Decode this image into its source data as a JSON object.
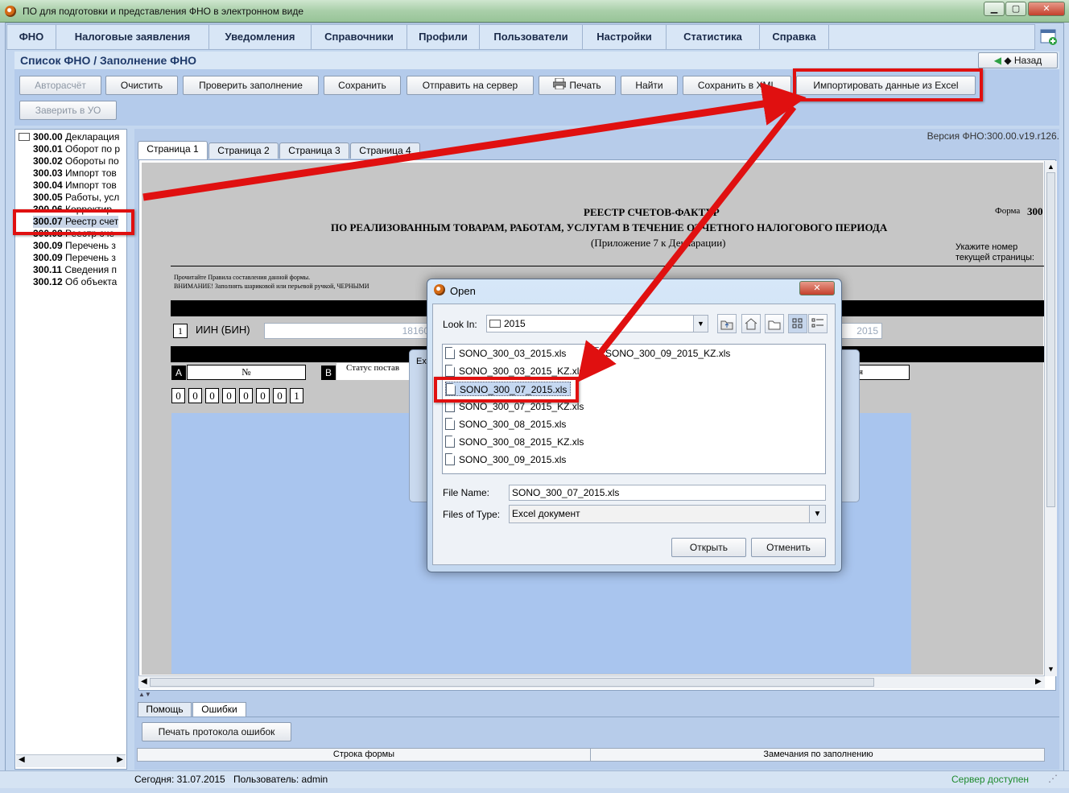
{
  "window": {
    "title": "ПО для подготовки и представления ФНО в электронном виде",
    "minimize": "▁",
    "maximize": "▢",
    "close": "✕"
  },
  "menu": [
    "ФНО",
    "Налоговые заявления",
    "Уведомления",
    "Справочники",
    "Профили",
    "Пользователи",
    "Настройки",
    "Статистика",
    "Справка"
  ],
  "header": {
    "title": "Список ФНО / Заполнение ФНО",
    "back": "◆ Назад"
  },
  "toolbar": {
    "autocalc": "Авторасчёт",
    "clear": "Очистить",
    "check": "Проверить заполнение",
    "save": "Сохранить",
    "send": "Отправить на сервер",
    "print": "Печать",
    "find": "Найти",
    "save_xml": "Сохранить в XML",
    "import_excel": "Импортировать данные из Excel",
    "certify": "Заверить в УО"
  },
  "tree": [
    {
      "code": "300.00",
      "label": "Декларация"
    },
    {
      "code": "300.01",
      "label": "Оборот по р"
    },
    {
      "code": "300.02",
      "label": "Обороты по"
    },
    {
      "code": "300.03",
      "label": "Импорт тов"
    },
    {
      "code": "300.04",
      "label": "Импорт тов"
    },
    {
      "code": "300.05",
      "label": "Работы, усл"
    },
    {
      "code": "300.06",
      "label": "Корректир"
    },
    {
      "code": "300.07",
      "label": "Реестр счет"
    },
    {
      "code": "300.08",
      "label": "Реестр сче"
    },
    {
      "code": "300.09",
      "label": "Перечень з"
    },
    {
      "code": "300.09",
      "label": "Перечень з"
    },
    {
      "code": "300.11",
      "label": "Сведения п"
    },
    {
      "code": "300.12",
      "label": "Об объекта"
    }
  ],
  "version": "Версия ФНО:300.00.v19.r126.",
  "tabs": [
    "Страница 1",
    "Страница 2",
    "Страница 3",
    "Страница 4"
  ],
  "form": {
    "title1": "РЕЕСТР СЧЕТОВ-ФАКТУР",
    "title2": "ПО РЕАЛИЗОВАННЫМ ТОВАРАМ, РАБОТАМ, УСЛУГАМ В ТЕЧЕНИЕ ОТЧЕТНОГО НАЛОГОВОГО ПЕРИОДА",
    "title3": "(Приложение 7 к Декларации)",
    "form_code_label": "Форма",
    "form_code": "300",
    "page_hint": "Укажите номер текущей страницы:",
    "rules_note": "Прочитайте Правила составления данной формы.",
    "warning_note": "ВНИМАНИЕ! Заполнять шариковой или перьевой ручкой, ЧЕРНЫМИ",
    "row1": "1",
    "iin_label": "ИИН (БИН)",
    "iin_value": "18160",
    "year_value": "2015",
    "col_a": "A",
    "col_no": "№",
    "col_b": "B",
    "col_status": "Статус постав",
    "col_tail": "я",
    "serial_digits": [
      "0",
      "0",
      "0",
      "0",
      "0",
      "0",
      "0",
      "1"
    ]
  },
  "bottom": {
    "help_tab": "Помощь",
    "errors_tab": "Ошибки",
    "print_errors": "Печать протокола ошибок",
    "col_row": "Строка формы",
    "col_remarks": "Замечания по заполнению"
  },
  "status": {
    "today": "Сегодня: 31.07.2015",
    "user": "Пользователь: admin",
    "server": "Сервер доступен"
  },
  "bg_dialog": {
    "title": "Ex"
  },
  "open_dialog": {
    "title": "Open",
    "look_in_label": "Look In:",
    "look_in_value": "2015",
    "files": [
      "SONO_300_03_2015.xls",
      "SONO_300_03_2015_KZ.xls",
      "SONO_300_07_2015.xls",
      "SONO_300_07_2015_KZ.xls",
      "SONO_300_08_2015.xls",
      "SONO_300_08_2015_KZ.xls",
      "SONO_300_09_2015.xls"
    ],
    "files_col2": [
      "SONO_300_09_2015_KZ.xls"
    ],
    "file_name_label": "File Name:",
    "file_name_value": "SONO_300_07_2015.xls",
    "files_type_label": "Files of Type:",
    "files_type_value": "Excel документ",
    "open_btn": "Открыть",
    "cancel_btn": "Отменить"
  },
  "colors": {
    "accent_red": "#e01010",
    "window_green": "#a9cfa9",
    "panel_blue": "#b7ccea"
  }
}
